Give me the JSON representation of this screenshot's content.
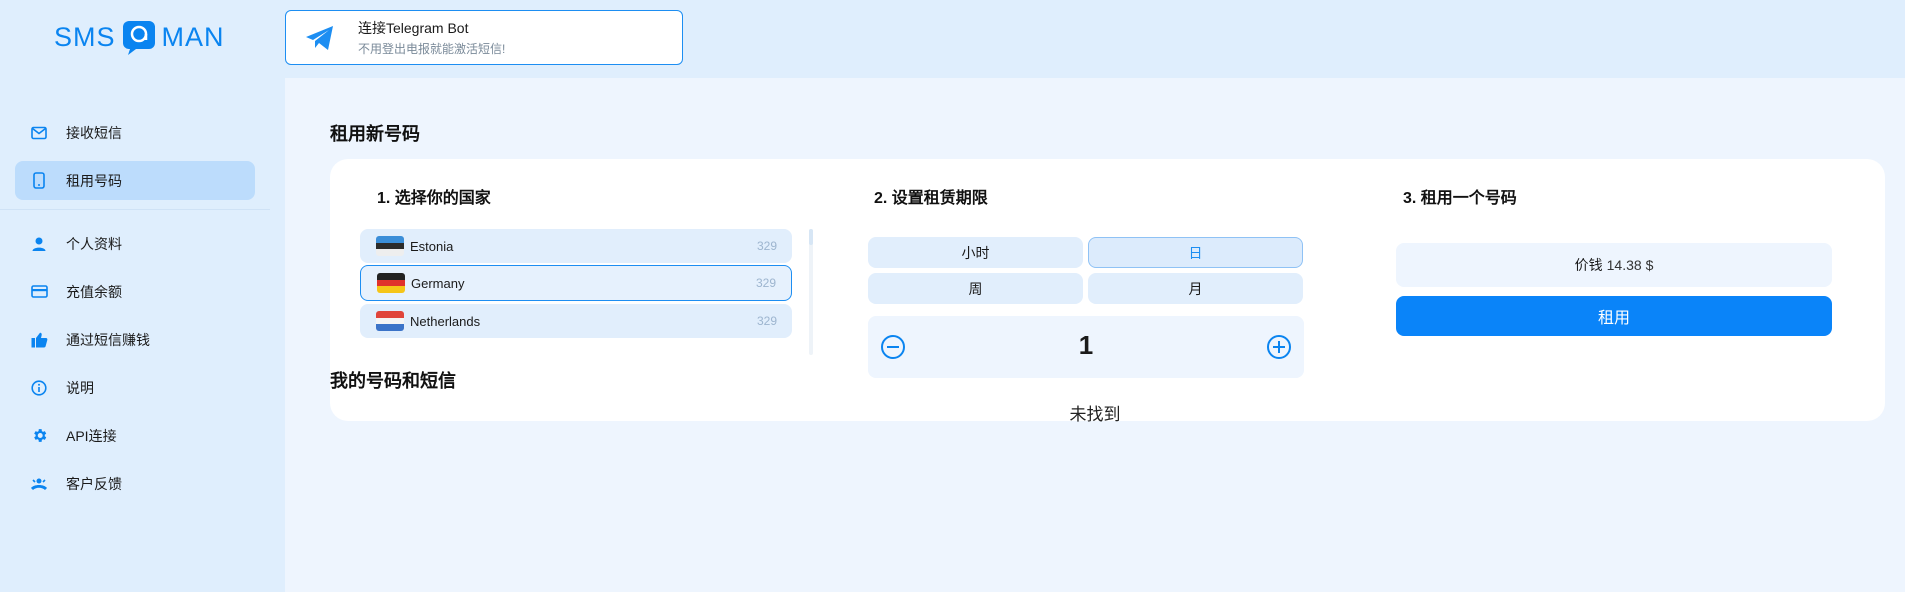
{
  "brand": {
    "left": "SMS",
    "right": "MAN",
    "color": "#0a84f0"
  },
  "telegram": {
    "title": "连接Telegram Bot",
    "subtitle": "不用登出电报就能激活短信!",
    "icon": "telegram-icon"
  },
  "sidebar": {
    "items": [
      {
        "label": "接收短信",
        "icon": "mail-icon",
        "active": false
      },
      {
        "label": "租用号码",
        "icon": "phone-icon",
        "active": true
      },
      {
        "label": "个人资料",
        "icon": "user-icon",
        "active": false
      },
      {
        "label": "充值余额",
        "icon": "card-icon",
        "active": false
      },
      {
        "label": "通过短信赚钱",
        "icon": "thumbs-up-icon",
        "active": false
      },
      {
        "label": "说明",
        "icon": "info-icon",
        "active": false
      },
      {
        "label": "API连接",
        "icon": "gear-icon",
        "active": false
      },
      {
        "label": "客户反馈",
        "icon": "support-icon",
        "active": false
      }
    ]
  },
  "main": {
    "rent_title": "租用新号码",
    "step1": {
      "title": "1. 选择你的国家",
      "countries": [
        {
          "name": "Estonia",
          "count": "329",
          "selected": false
        },
        {
          "name": "Germany",
          "count": "329",
          "selected": true
        },
        {
          "name": "Netherlands",
          "count": "329",
          "selected": false
        }
      ]
    },
    "step2": {
      "title": "2. 设置租赁期限",
      "periods": [
        {
          "label": "小时",
          "selected": false
        },
        {
          "label": "日",
          "selected": true
        },
        {
          "label": "周",
          "selected": false
        },
        {
          "label": "月",
          "selected": false
        }
      ],
      "quantity": "1"
    },
    "step3": {
      "title": "3. 租用一个号码",
      "price_label": "价钱",
      "price_value": "14.38 $",
      "rent_button": "租用"
    },
    "my_numbers_title": "我的号码和短信",
    "empty_text": "未找到"
  },
  "colors": {
    "accent": "#0a84f9",
    "sidebar_bg": "#dfeefd",
    "active_bg": "#bcdcfc"
  }
}
